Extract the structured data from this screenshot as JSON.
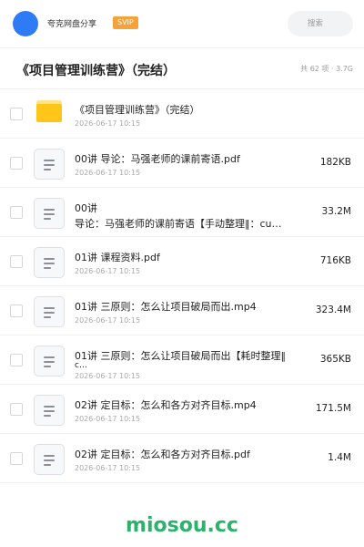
{
  "header": {
    "app_title": "夸克网盘分享",
    "badge": "SVIP",
    "search_placeholder": "搜索"
  },
  "folder": {
    "title": "《项目管理训练营》（完结）",
    "meta": "共 62 项 · 3.7G"
  },
  "items": [
    {
      "type": "folder",
      "name": "《项目管理训练营》（完结）",
      "date": "2026-06-17 10:15",
      "size": ""
    },
    {
      "type": "file",
      "name": "00讲 导论：马强老师的课前寄语.pdf",
      "date": "2026-06-17 10:15",
      "size": "182KB"
    },
    {
      "type": "file",
      "name": "00讲",
      "name2": "导论：马强老师的课前寄语【手动整理‖：cu…",
      "date": "2026-06-17 10:15",
      "size": "33.2M"
    },
    {
      "type": "file",
      "name": "01讲 课程资料.pdf",
      "date": "2026-06-17 10:15",
      "size": "716KB"
    },
    {
      "type": "file",
      "name": "01讲 三原则：怎么让项目破局而出.mp4",
      "date": "2026-06-17 10:15",
      "size": "323.4M"
    },
    {
      "type": "file",
      "name": "01讲 三原则：怎么让项目破局而出【耗时整理‖",
      "name2": "c…",
      "date": "2026-06-17 10:15",
      "size": "365KB"
    },
    {
      "type": "file",
      "name": "02讲 定目标：怎么和各方对齐目标.mp4",
      "date": "2026-06-17 10:15",
      "size": "171.5M"
    },
    {
      "type": "file",
      "name": "02讲 定目标：怎么和各方对齐目标.pdf",
      "date": "2026-06-17 10:15",
      "size": "1.4M"
    }
  ],
  "footer": {
    "brand": "miosou.cc"
  },
  "colors": {
    "accent": "#2f7bf5",
    "badge": "#f5a23a",
    "brand": "#2bb36c",
    "folder": "#ffc61a"
  }
}
